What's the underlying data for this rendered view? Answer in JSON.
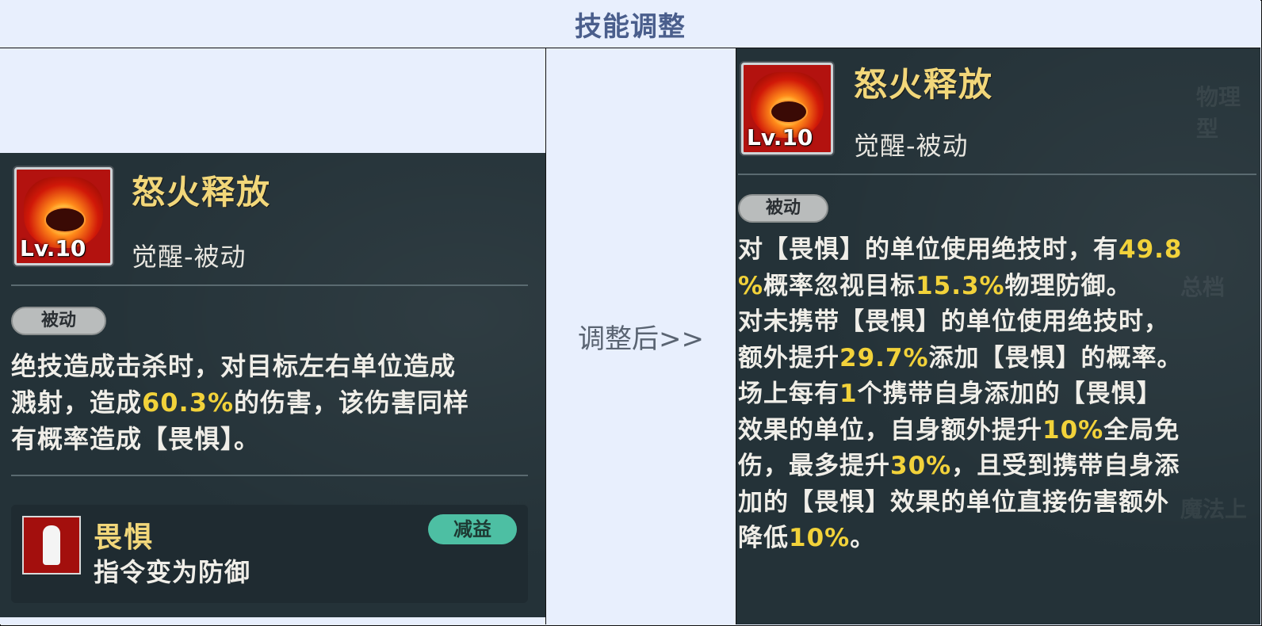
{
  "header": {
    "title": "技能调整"
  },
  "middle": {
    "label": "调整后>>"
  },
  "before": {
    "skill_name": "怒火释放",
    "level": "Lv.10",
    "category": "觉醒-被动",
    "tag": "被动",
    "description": [
      [
        {
          "t": "绝技造成击杀时，对目标左右单位造成"
        }
      ],
      [
        {
          "t": "溅射，造成"
        },
        {
          "t": "60.3%",
          "hl": true
        },
        {
          "t": "的伤害，该伤害同样"
        }
      ],
      [
        {
          "t": "有概率造成【畏惧】。"
        }
      ]
    ],
    "status": {
      "name": "畏惧",
      "effect": "指令变为防御",
      "badge": "减益",
      "badge_color": "#4dbfa3"
    }
  },
  "after": {
    "skill_name": "怒火释放",
    "level": "Lv.10",
    "category": "觉醒-被动",
    "tag": "被动",
    "description": [
      [
        {
          "t": "对【畏惧】的单位使用绝技时，有"
        },
        {
          "t": "49.8",
          "hl": true
        }
      ],
      [
        {
          "t": "%",
          "hl": true
        },
        {
          "t": "概率忽视目标"
        },
        {
          "t": "15.3%",
          "hl": true
        },
        {
          "t": "物理防御。"
        }
      ],
      [
        {
          "t": "对未携带【畏惧】的单位使用绝技时，"
        }
      ],
      [
        {
          "t": "额外提升"
        },
        {
          "t": "29.7%",
          "hl": true
        },
        {
          "t": "添加【畏惧】的概率。"
        }
      ],
      [
        {
          "t": "场上每有"
        },
        {
          "t": "1",
          "hl": true
        },
        {
          "t": "个携带自身添加的【畏惧】"
        }
      ],
      [
        {
          "t": "效果的单位，自身额外提升"
        },
        {
          "t": "10%",
          "hl": true
        },
        {
          "t": "全局免"
        }
      ],
      [
        {
          "t": "伤，最多提升"
        },
        {
          "t": "30%",
          "hl": true
        },
        {
          "t": "，且受到携带自身添"
        }
      ],
      [
        {
          "t": "加的【畏惧】效果的单位直接伤害额外"
        }
      ],
      [
        {
          "t": "降低"
        },
        {
          "t": "10%",
          "hl": true
        },
        {
          "t": "。"
        }
      ]
    ]
  },
  "colors": {
    "highlight": "#f2d23a",
    "title_gold": "#f2d77a",
    "panel_bg": "#243238",
    "table_bg": "#e8effd"
  }
}
